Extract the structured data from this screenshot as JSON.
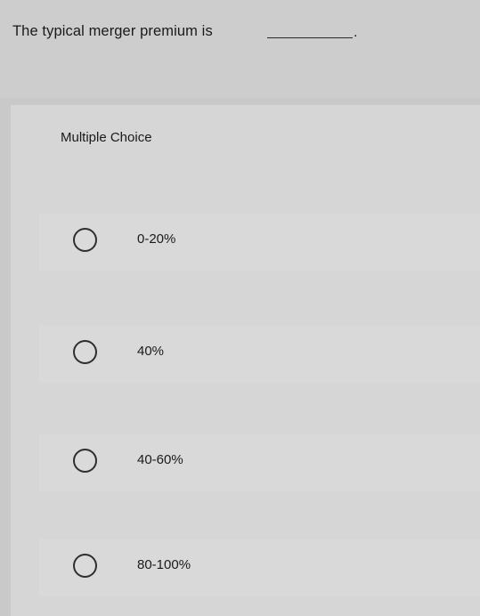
{
  "question": {
    "text": "The typical merger premium is",
    "period": "."
  },
  "panel": {
    "title": "Multiple Choice",
    "options": [
      {
        "label": "0-20%"
      },
      {
        "label": "40%"
      },
      {
        "label": "40-60%"
      },
      {
        "label": "80-100%"
      }
    ]
  }
}
